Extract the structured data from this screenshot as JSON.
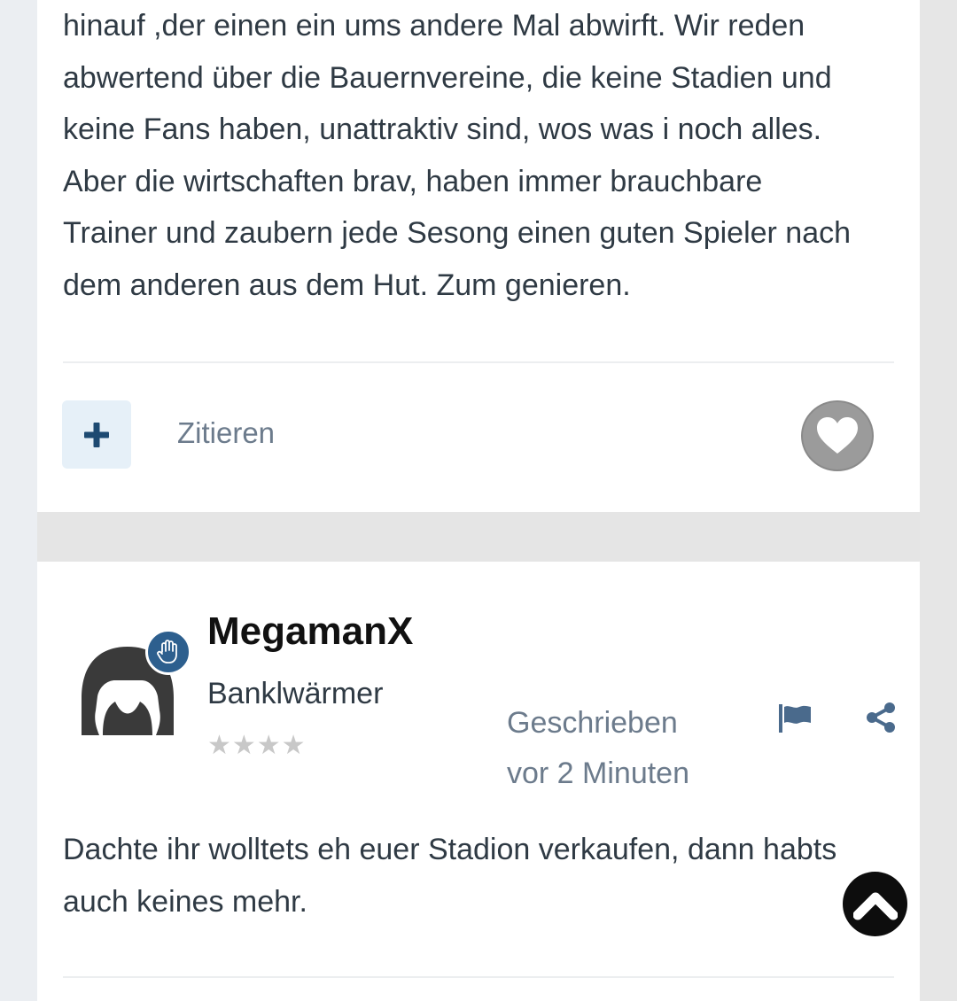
{
  "previous_post": {
    "lines": [
      "hinauf ,der einen ein ums andere Mal abwirft. Wir reden",
      "abwertend über die Bauernvereine, die keine Stadien und",
      "keine Fans haben, unattraktiv sind, wos was i noch alles.",
      "Aber die wirtschaften brav, haben immer brauchbare",
      "Trainer und zaubern jede Sesong einen guten Spieler nach",
      "dem anderen aus dem Hut. Zum genieren."
    ],
    "actions": {
      "quote_label": "Zitieren",
      "plus_icon": "plus-icon",
      "like_icon": "heart-icon"
    }
  },
  "post": {
    "author": {
      "name": "MegamanX",
      "rank": "Banklwärmer",
      "stars": "★★★★",
      "badge_icon": "raised-hand-icon"
    },
    "posted_line1": "Geschrieben",
    "posted_line2": "vor 2 Minuten",
    "icons": {
      "report": "flag-icon",
      "share": "share-icon"
    },
    "lines": [
      "Dachte ihr wolltets eh euer Stadion verkaufen, dann habts",
      "auch keines mehr."
    ]
  },
  "floating": {
    "scroll_top_icon": "chevron-up-icon"
  },
  "colors": {
    "accent": "#2d5f8e",
    "text": "#2f3a44",
    "muted": "#6c7b8c",
    "like": "#9b9b9b"
  }
}
